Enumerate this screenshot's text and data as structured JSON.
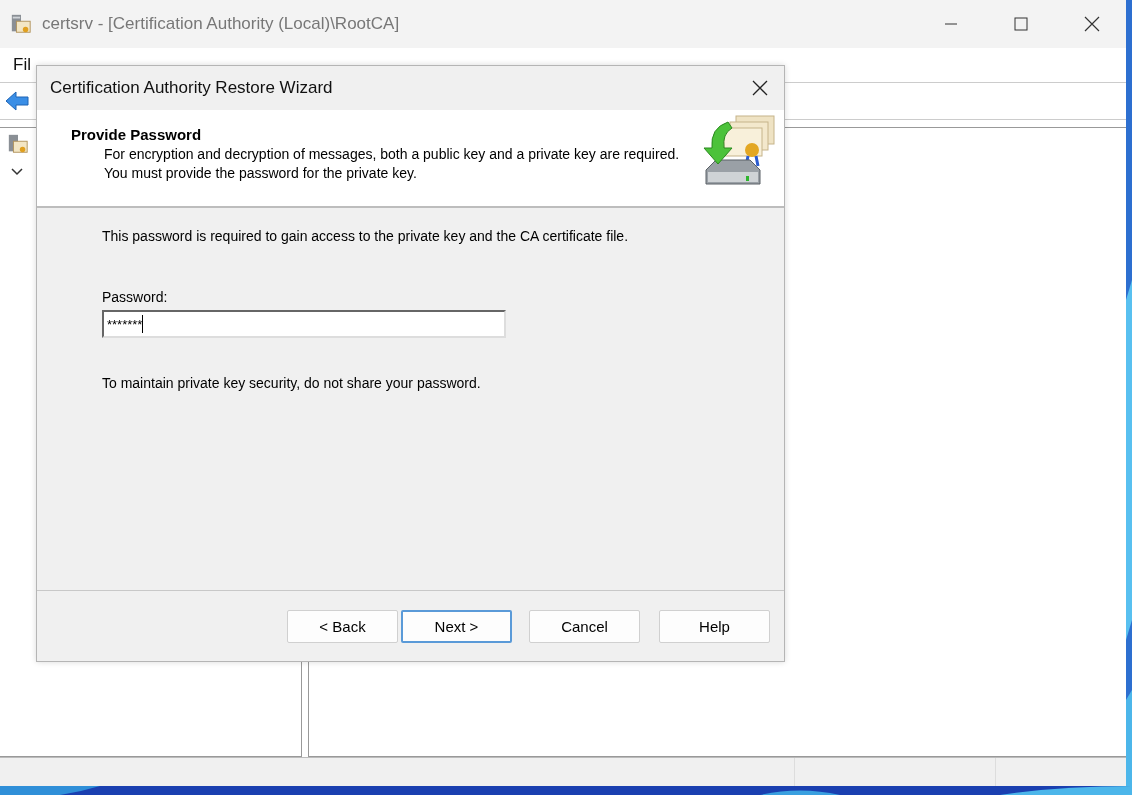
{
  "window": {
    "title": "certsrv - [Certification Authority (Local)\\RootCA]"
  },
  "menu": [
    "Fil"
  ],
  "dialog": {
    "title": "Certification Authority Restore Wizard",
    "header": {
      "title": "Provide Password",
      "description": "For encryption and decryption of messages, both a public key and a private key are required. You must provide the password for the private key."
    },
    "intro": "This password is required to gain access to the private key and the CA certificate file.",
    "password": {
      "label": "Password:",
      "value": "*******",
      "focused": true
    },
    "note": "To maintain private key security, do not share your password.",
    "buttons": [
      {
        "label": "< Back",
        "default": false
      },
      {
        "label": "Next >",
        "default": true
      },
      {
        "label": "Cancel",
        "default": false
      },
      {
        "label": "Help",
        "default": false
      }
    ]
  }
}
